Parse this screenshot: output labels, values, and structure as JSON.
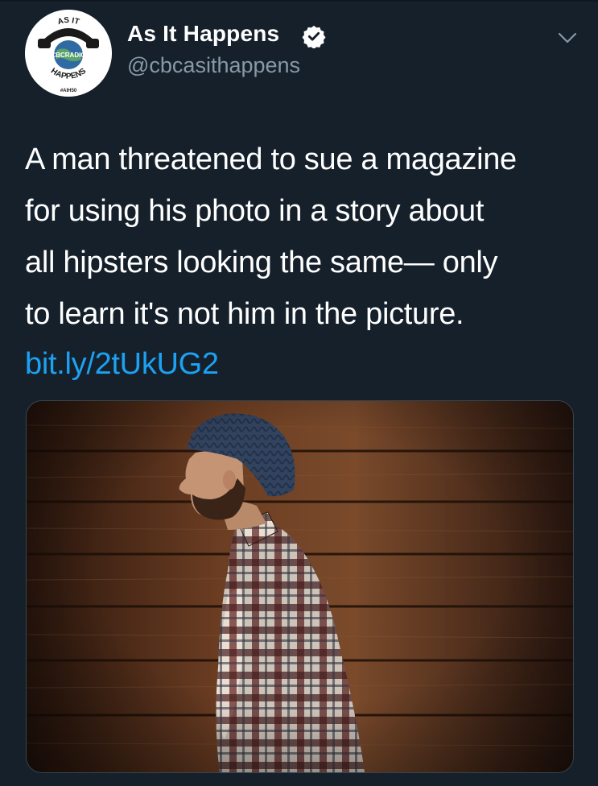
{
  "account": {
    "display_name": "As It Happens",
    "handle": "@cbcasithappens",
    "verified": true,
    "avatar": {
      "arc_top": "AS IT",
      "middle": "CBCRADIO",
      "arc_bottom": "HAPPENS",
      "footer": "#AIH50"
    }
  },
  "tweet": {
    "lines": [
      "A man threatened to sue a magazine",
      "for using his photo in a story about",
      "all hipsters looking the same— only",
      "to learn it's not him in the picture."
    ],
    "link": "bit.ly/2tUkUG2"
  },
  "media": {
    "subject": "man-in-beanie-and-plaid-shirt-profile"
  },
  "colors": {
    "background": "#15202b",
    "text": "#ffffff",
    "secondary": "#8899a6",
    "link": "#1da1f2",
    "verified": "#ffffff"
  },
  "icons": {
    "verified": "verified-badge-icon",
    "menu": "chevron-down-icon"
  }
}
